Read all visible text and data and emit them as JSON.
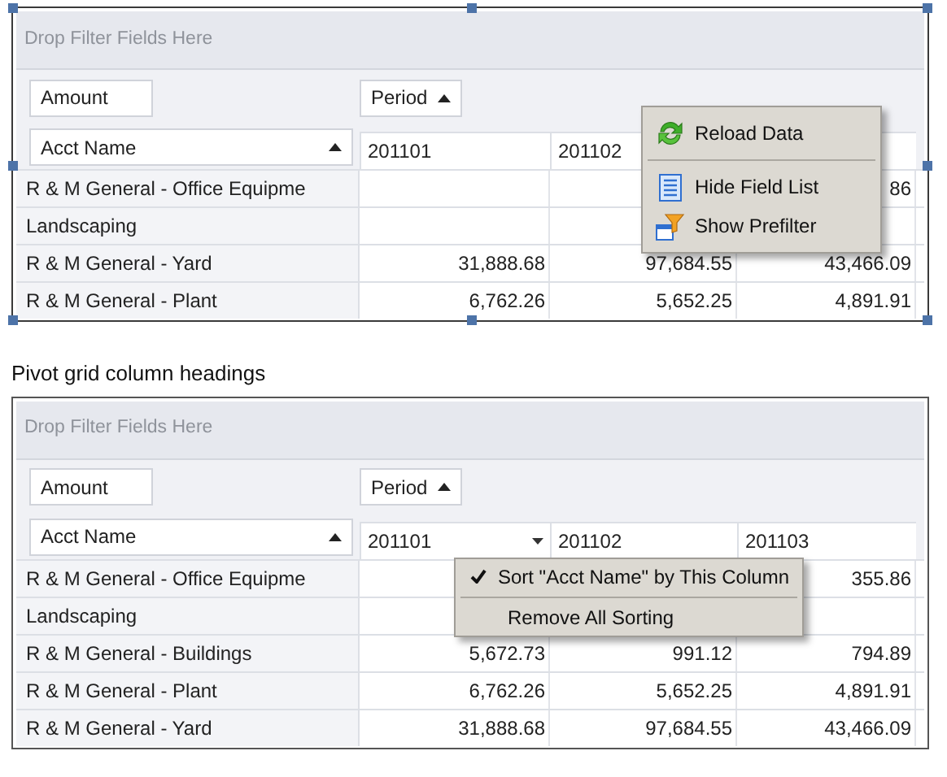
{
  "panels": [
    {
      "selected": true,
      "filter_hint": "Drop Filter Fields Here",
      "data_field": "Amount",
      "column_field": {
        "label": "Period",
        "sort_ascending": true
      },
      "row_field": {
        "label": "Acct Name",
        "sort_ascending": true
      },
      "columns": [
        {
          "label": "201101",
          "dropdown": false
        },
        {
          "label": "201102",
          "dropdown": false
        }
      ],
      "rows": [
        {
          "name": "R & M General - Office Equipme",
          "cells": [
            null,
            null,
            "86"
          ]
        },
        {
          "name": "Landscaping",
          "cells": [
            null,
            null,
            null
          ]
        },
        {
          "name": "R & M General - Yard",
          "cells": [
            "31,888.68",
            "97,684.55",
            "43,466.09"
          ]
        },
        {
          "name": "R & M General - Plant",
          "cells": [
            "6,762.26",
            "5,652.25",
            "4,891.91"
          ]
        }
      ],
      "menu": {
        "groups": [
          [
            {
              "kind": "reload",
              "label": "Reload Data"
            }
          ],
          [
            {
              "kind": "list",
              "label": "Hide Field List"
            },
            {
              "kind": "prefilter",
              "label": "Show Prefilter"
            }
          ]
        ]
      }
    },
    {
      "caption": "Pivot grid column headings",
      "selected": false,
      "filter_hint": "Drop Filter Fields Here",
      "data_field": "Amount",
      "column_field": {
        "label": "Period",
        "sort_ascending": true
      },
      "row_field": {
        "label": "Acct Name",
        "sort_ascending": true
      },
      "columns": [
        {
          "label": "201101",
          "dropdown": true
        },
        {
          "label": "201102",
          "dropdown": false
        },
        {
          "label": "201103",
          "dropdown": false
        }
      ],
      "rows": [
        {
          "name": "R & M General - Office Equipme",
          "cells": [
            null,
            null,
            "355.86"
          ]
        },
        {
          "name": "Landscaping",
          "cells": [
            null,
            null,
            null
          ]
        },
        {
          "name": "R & M General - Buildings",
          "cells": [
            "5,672.73",
            "991.12",
            "794.89"
          ]
        },
        {
          "name": "R & M General - Plant",
          "cells": [
            "6,762.26",
            "5,652.25",
            "4,891.91"
          ]
        },
        {
          "name": "R & M General - Yard",
          "cells": [
            "31,888.68",
            "97,684.55",
            "43,466.09"
          ]
        }
      ],
      "menu": {
        "groups": [
          [
            {
              "kind": "text",
              "label": "Sort \"Acct Name\" by This Column",
              "checked": true
            }
          ],
          [
            {
              "kind": "text",
              "label": "Remove All Sorting",
              "checked": false
            }
          ]
        ]
      }
    }
  ]
}
